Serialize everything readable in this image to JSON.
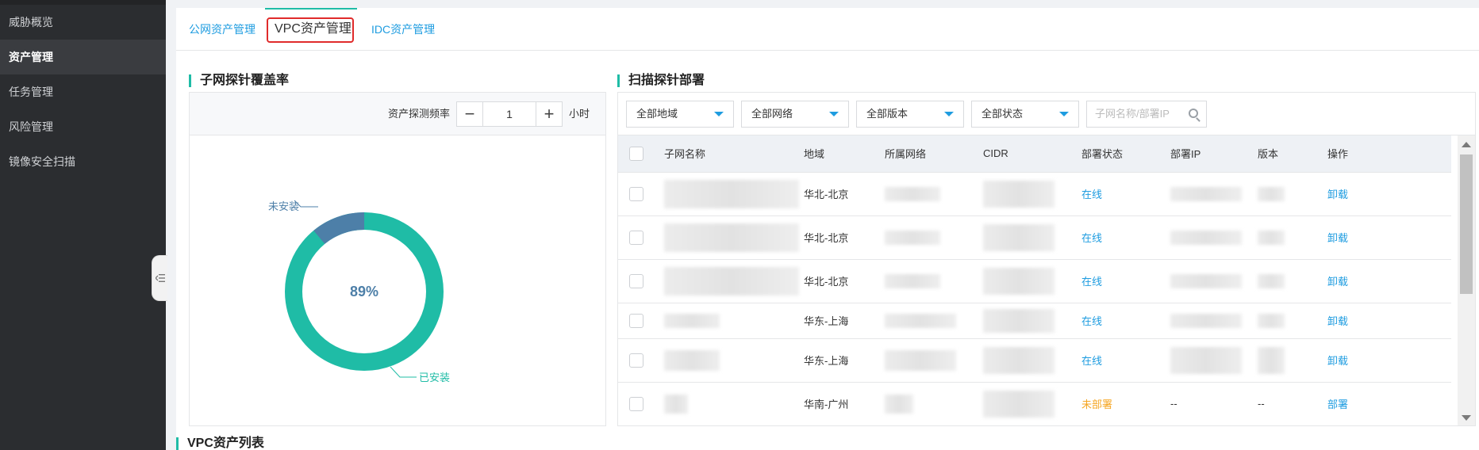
{
  "sidebar": {
    "items": [
      {
        "label": "威胁概览",
        "active": false
      },
      {
        "label": "资产管理",
        "active": true
      },
      {
        "label": "任务管理",
        "active": false
      },
      {
        "label": "风险管理",
        "active": false
      },
      {
        "label": "镜像安全扫描",
        "active": false
      }
    ]
  },
  "tabs": [
    {
      "label": "公网资产管理"
    },
    {
      "label": "VPC资产管理"
    },
    {
      "label": "IDC资产管理"
    }
  ],
  "coverage": {
    "title": "子网探针覆盖率",
    "freq_label": "资产探测频率",
    "freq_value": "1",
    "freq_unit": "小时",
    "percent_text": "89%",
    "installed_fraction": 0.89,
    "installed_label": "已安装",
    "not_installed_label": "未安装",
    "colors": {
      "installed": "#1fbca6",
      "not_installed": "#4d7fa8"
    }
  },
  "deploy": {
    "title": "扫描探针部署",
    "filters": [
      "全部地域",
      "全部网络",
      "全部版本",
      "全部状态"
    ],
    "search_placeholder": "子网名称/部署IP",
    "columns": [
      "子网名称",
      "地域",
      "所属网络",
      "CIDR",
      "部署状态",
      "部署IP",
      "版本",
      "操作"
    ],
    "rows": [
      {
        "region": "华北-北京",
        "status": "在线",
        "status_type": "online",
        "ip": "",
        "version": "",
        "action": "卸载"
      },
      {
        "region": "华北-北京",
        "status": "在线",
        "status_type": "online",
        "ip": "",
        "version": "",
        "action": "卸载"
      },
      {
        "region": "华北-北京",
        "status": "在线",
        "status_type": "online",
        "ip": "",
        "version": "",
        "action": "卸载"
      },
      {
        "region": "华东-上海",
        "status": "在线",
        "status_type": "online",
        "ip": "",
        "version": "",
        "action": "卸载"
      },
      {
        "region": "华东-上海",
        "status": "在线",
        "status_type": "online",
        "ip": "",
        "version": "",
        "action": "卸载"
      },
      {
        "region": "华南-广州",
        "status": "未部署",
        "status_type": "none",
        "ip": "--",
        "version": "--",
        "action": "部署"
      }
    ]
  },
  "vpc_list": {
    "title": "VPC资产列表"
  }
}
